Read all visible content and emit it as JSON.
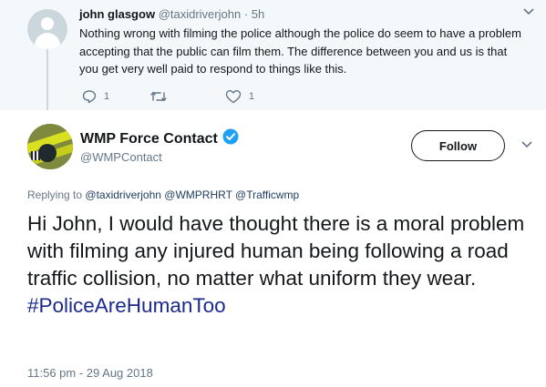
{
  "parent_tweet": {
    "name": "john glasgow",
    "handle": "@taxidriverjohn",
    "separator": "·",
    "time": "5h",
    "text": "Nothing wrong with filming the police although the police do seem to have a problem accepting that the public can film them. The difference between you and us is that you get very well paid to respond to things like this.",
    "reply_count": "1",
    "like_count": "1",
    "icons": [
      "reply-icon",
      "retweet-icon",
      "like-icon",
      "chevron-down-icon"
    ]
  },
  "main_tweet": {
    "name": "WMP Force Contact",
    "handle": "@WMPContact",
    "verified": true,
    "follow_label": "Follow",
    "replying_prefix": "Replying to",
    "replying_mentions": "@taxidriverjohn @WMPRHRT @Trafficwmp",
    "text_body": "Hi John, I would have thought there is a moral problem with filming any injured human being following a road traffic collision, no matter what uniform they wear.",
    "hashtag": "#PoliceAreHumanToo",
    "timestamp": "11:56 pm - 29 Aug 2018"
  },
  "colors": {
    "accent": "#1da1f2",
    "hashtag": "#1b2a8c",
    "muted": "#657786",
    "parent_bg": "#f5f8fa"
  }
}
